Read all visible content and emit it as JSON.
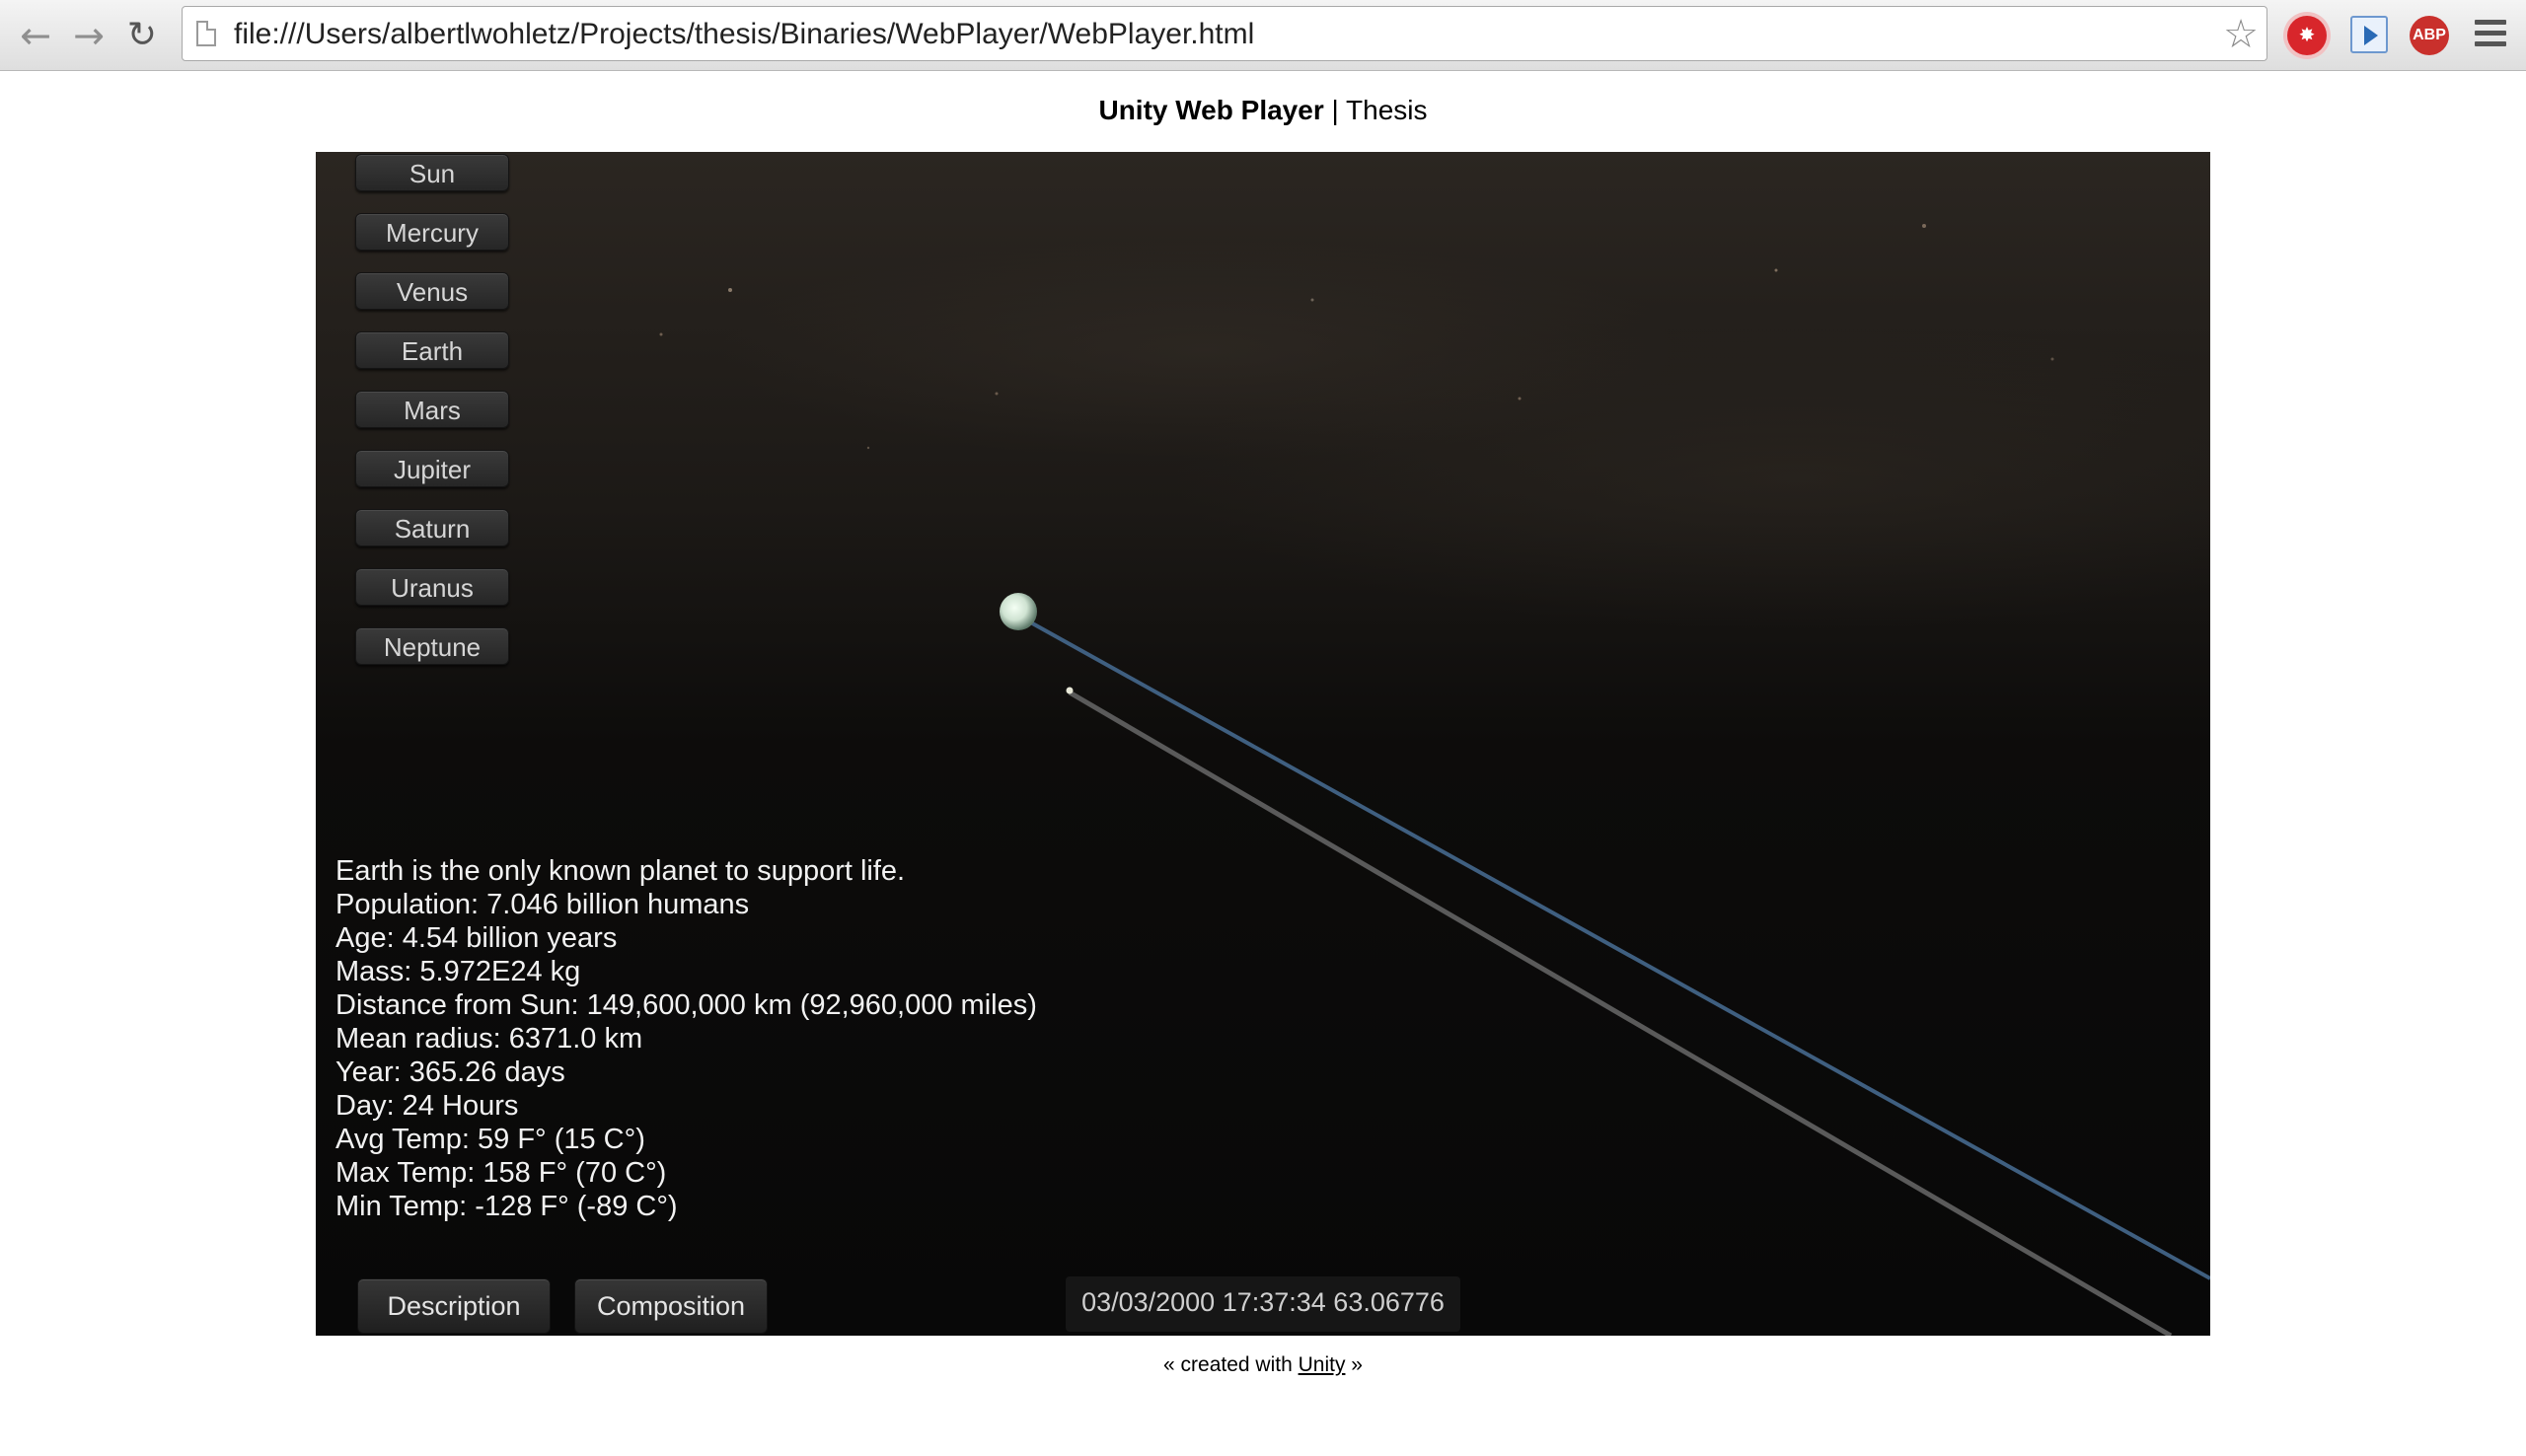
{
  "browser": {
    "back_icon": "arrow-left-icon",
    "forward_icon": "arrow-right-icon",
    "reload_icon": "reload-icon",
    "url": "file:///Users/albertlwohletz/Projects/thesis/Binaries/WebPlayer/WebPlayer.html",
    "extensions": {
      "abp_label": "ABP"
    }
  },
  "page": {
    "title_bold": "Unity Web Player",
    "title_separator": " | ",
    "title_rest": "Thesis"
  },
  "player": {
    "planet_buttons": [
      "Sun",
      "Mercury",
      "Venus",
      "Earth",
      "Mars",
      "Jupiter",
      "Saturn",
      "Uranus",
      "Neptune"
    ],
    "info_lines": [
      "Earth is the only known planet to support life.",
      "Population: 7.046 billion humans",
      "Age: 4.54 billion years",
      "Mass: 5.972E24 kg",
      "Distance from Sun: 149,600,000 km (92,960,000 miles)",
      "Mean radius: 6371.0 km",
      "Year: 365.26 days",
      "Day: 24 Hours",
      "Avg Temp: 59 F° (15 C°)",
      "Max Temp: 158 F° (70 C°)",
      "Min Temp: -128 F° (-89 C°)"
    ],
    "tabs": {
      "description": "Description",
      "composition": "Composition"
    },
    "clock": "03/03/2000 17:37:34 63.06776",
    "colors": {
      "earth_orbit": "#3f5f80",
      "moon_orbit": "#5a5a5a"
    }
  },
  "footer": {
    "prefix": "« created with ",
    "link": "Unity",
    "suffix": " »"
  }
}
